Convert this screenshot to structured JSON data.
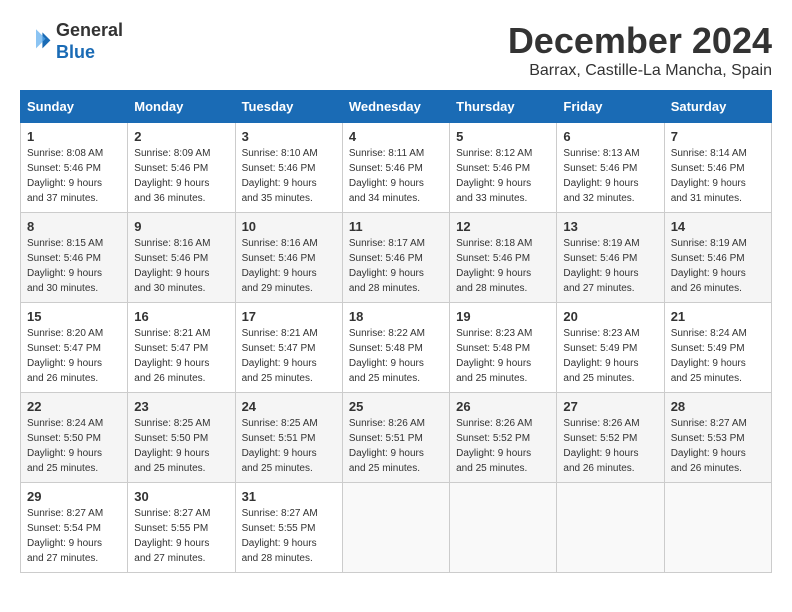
{
  "header": {
    "logo_line1": "General",
    "logo_line2": "Blue",
    "month": "December 2024",
    "location": "Barrax, Castille-La Mancha, Spain"
  },
  "weekdays": [
    "Sunday",
    "Monday",
    "Tuesday",
    "Wednesday",
    "Thursday",
    "Friday",
    "Saturday"
  ],
  "weeks": [
    [
      {
        "day": "1",
        "sunrise": "Sunrise: 8:08 AM",
        "sunset": "Sunset: 5:46 PM",
        "daylight": "Daylight: 9 hours and 37 minutes."
      },
      {
        "day": "2",
        "sunrise": "Sunrise: 8:09 AM",
        "sunset": "Sunset: 5:46 PM",
        "daylight": "Daylight: 9 hours and 36 minutes."
      },
      {
        "day": "3",
        "sunrise": "Sunrise: 8:10 AM",
        "sunset": "Sunset: 5:46 PM",
        "daylight": "Daylight: 9 hours and 35 minutes."
      },
      {
        "day": "4",
        "sunrise": "Sunrise: 8:11 AM",
        "sunset": "Sunset: 5:46 PM",
        "daylight": "Daylight: 9 hours and 34 minutes."
      },
      {
        "day": "5",
        "sunrise": "Sunrise: 8:12 AM",
        "sunset": "Sunset: 5:46 PM",
        "daylight": "Daylight: 9 hours and 33 minutes."
      },
      {
        "day": "6",
        "sunrise": "Sunrise: 8:13 AM",
        "sunset": "Sunset: 5:46 PM",
        "daylight": "Daylight: 9 hours and 32 minutes."
      },
      {
        "day": "7",
        "sunrise": "Sunrise: 8:14 AM",
        "sunset": "Sunset: 5:46 PM",
        "daylight": "Daylight: 9 hours and 31 minutes."
      }
    ],
    [
      {
        "day": "8",
        "sunrise": "Sunrise: 8:15 AM",
        "sunset": "Sunset: 5:46 PM",
        "daylight": "Daylight: 9 hours and 30 minutes."
      },
      {
        "day": "9",
        "sunrise": "Sunrise: 8:16 AM",
        "sunset": "Sunset: 5:46 PM",
        "daylight": "Daylight: 9 hours and 30 minutes."
      },
      {
        "day": "10",
        "sunrise": "Sunrise: 8:16 AM",
        "sunset": "Sunset: 5:46 PM",
        "daylight": "Daylight: 9 hours and 29 minutes."
      },
      {
        "day": "11",
        "sunrise": "Sunrise: 8:17 AM",
        "sunset": "Sunset: 5:46 PM",
        "daylight": "Daylight: 9 hours and 28 minutes."
      },
      {
        "day": "12",
        "sunrise": "Sunrise: 8:18 AM",
        "sunset": "Sunset: 5:46 PM",
        "daylight": "Daylight: 9 hours and 28 minutes."
      },
      {
        "day": "13",
        "sunrise": "Sunrise: 8:19 AM",
        "sunset": "Sunset: 5:46 PM",
        "daylight": "Daylight: 9 hours and 27 minutes."
      },
      {
        "day": "14",
        "sunrise": "Sunrise: 8:19 AM",
        "sunset": "Sunset: 5:46 PM",
        "daylight": "Daylight: 9 hours and 26 minutes."
      }
    ],
    [
      {
        "day": "15",
        "sunrise": "Sunrise: 8:20 AM",
        "sunset": "Sunset: 5:47 PM",
        "daylight": "Daylight: 9 hours and 26 minutes."
      },
      {
        "day": "16",
        "sunrise": "Sunrise: 8:21 AM",
        "sunset": "Sunset: 5:47 PM",
        "daylight": "Daylight: 9 hours and 26 minutes."
      },
      {
        "day": "17",
        "sunrise": "Sunrise: 8:21 AM",
        "sunset": "Sunset: 5:47 PM",
        "daylight": "Daylight: 9 hours and 25 minutes."
      },
      {
        "day": "18",
        "sunrise": "Sunrise: 8:22 AM",
        "sunset": "Sunset: 5:48 PM",
        "daylight": "Daylight: 9 hours and 25 minutes."
      },
      {
        "day": "19",
        "sunrise": "Sunrise: 8:23 AM",
        "sunset": "Sunset: 5:48 PM",
        "daylight": "Daylight: 9 hours and 25 minutes."
      },
      {
        "day": "20",
        "sunrise": "Sunrise: 8:23 AM",
        "sunset": "Sunset: 5:49 PM",
        "daylight": "Daylight: 9 hours and 25 minutes."
      },
      {
        "day": "21",
        "sunrise": "Sunrise: 8:24 AM",
        "sunset": "Sunset: 5:49 PM",
        "daylight": "Daylight: 9 hours and 25 minutes."
      }
    ],
    [
      {
        "day": "22",
        "sunrise": "Sunrise: 8:24 AM",
        "sunset": "Sunset: 5:50 PM",
        "daylight": "Daylight: 9 hours and 25 minutes."
      },
      {
        "day": "23",
        "sunrise": "Sunrise: 8:25 AM",
        "sunset": "Sunset: 5:50 PM",
        "daylight": "Daylight: 9 hours and 25 minutes."
      },
      {
        "day": "24",
        "sunrise": "Sunrise: 8:25 AM",
        "sunset": "Sunset: 5:51 PM",
        "daylight": "Daylight: 9 hours and 25 minutes."
      },
      {
        "day": "25",
        "sunrise": "Sunrise: 8:26 AM",
        "sunset": "Sunset: 5:51 PM",
        "daylight": "Daylight: 9 hours and 25 minutes."
      },
      {
        "day": "26",
        "sunrise": "Sunrise: 8:26 AM",
        "sunset": "Sunset: 5:52 PM",
        "daylight": "Daylight: 9 hours and 25 minutes."
      },
      {
        "day": "27",
        "sunrise": "Sunrise: 8:26 AM",
        "sunset": "Sunset: 5:52 PM",
        "daylight": "Daylight: 9 hours and 26 minutes."
      },
      {
        "day": "28",
        "sunrise": "Sunrise: 8:27 AM",
        "sunset": "Sunset: 5:53 PM",
        "daylight": "Daylight: 9 hours and 26 minutes."
      }
    ],
    [
      {
        "day": "29",
        "sunrise": "Sunrise: 8:27 AM",
        "sunset": "Sunset: 5:54 PM",
        "daylight": "Daylight: 9 hours and 27 minutes."
      },
      {
        "day": "30",
        "sunrise": "Sunrise: 8:27 AM",
        "sunset": "Sunset: 5:55 PM",
        "daylight": "Daylight: 9 hours and 27 minutes."
      },
      {
        "day": "31",
        "sunrise": "Sunrise: 8:27 AM",
        "sunset": "Sunset: 5:55 PM",
        "daylight": "Daylight: 9 hours and 28 minutes."
      },
      null,
      null,
      null,
      null
    ]
  ]
}
